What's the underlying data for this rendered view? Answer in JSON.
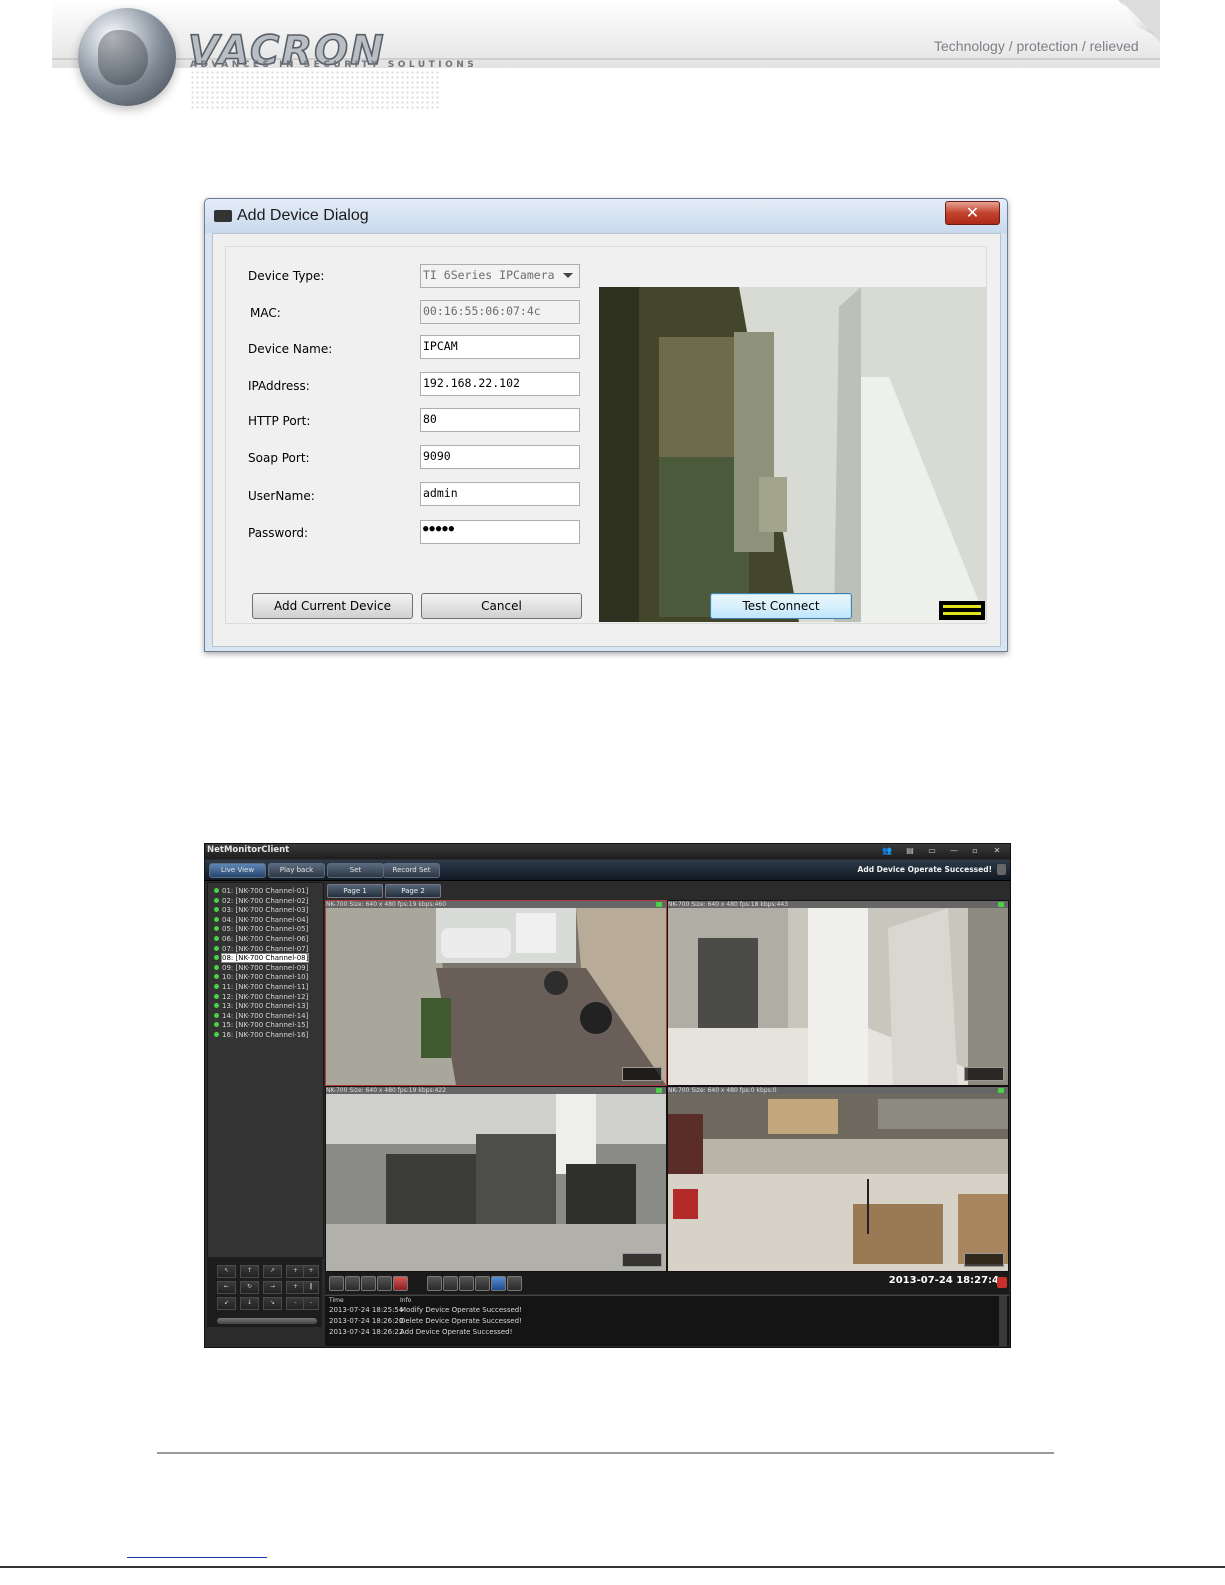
{
  "header": {
    "brand": "VACRON",
    "brand_sub": "ADVANCES IN SECURITY SOLUTIONS",
    "tagline": "Technology / protection / relieved"
  },
  "dialog": {
    "title": "Add Device Dialog",
    "close_glyph": "✕",
    "fields": [
      {
        "label": "Device Type:",
        "value": "TI 6Series IPCamera"
      },
      {
        "label": "MAC:",
        "value": "00:16:55:06:07:4c"
      },
      {
        "label": "Device Name:",
        "value": "IPCAM"
      },
      {
        "label": "IPAddress:",
        "value": "192.168.22.102"
      },
      {
        "label": "HTTP Port:",
        "value": "80"
      },
      {
        "label": "Soap Port:",
        "value": "9090"
      },
      {
        "label": "UserName:",
        "value": "admin"
      },
      {
        "label": "Password:",
        "value": "●●●●●"
      }
    ],
    "buttons": {
      "add": "Add Current Device",
      "cancel": "Cancel",
      "test": "Test Connect"
    }
  },
  "client": {
    "title": "NetMonitorClient",
    "window_buttons": [
      "👥",
      "▤",
      "▭",
      "—",
      "▫",
      "✕"
    ],
    "tabs": [
      "Live View",
      "Play back",
      "Set",
      "Record Set"
    ],
    "status": "Add Device Operate Successed!",
    "channels": [
      "01: [NK-700 Channel-01]",
      "02: [NK-700 Channel-02]",
      "03: [NK-700 Channel-03]",
      "04: [NK-700 Channel-04]",
      "05: [NK-700 Channel-05]",
      "06: [NK-700 Channel-06]",
      "07: [NK-700 Channel-07]",
      "08: [NK-700 Channel-08]",
      "09: [NK-700 Channel-09]",
      "10: [NK-700 Channel-10]",
      "11: [NK-700 Channel-11]",
      "12: [NK-700 Channel-12]",
      "13: [NK-700 Channel-13]",
      "14: [NK-700 Channel-14]",
      "15: [NK-700 Channel-15]",
      "16: [NK-700 Channel-16]"
    ],
    "selected_channel": 7,
    "pages": [
      "Page 1",
      "Page 2"
    ],
    "cameras": [
      {
        "caption": "NK-700 Size: 640 x 480 fps:19 kbps:460"
      },
      {
        "caption": "NK-700 Size: 640 x 480 fps:18 kbps:443"
      },
      {
        "caption": "NK-700 Size: 640 x 480 fps:19 kbps:422"
      },
      {
        "caption": "NK-700 Size: 640 x 480 fps:0 kbps:0"
      }
    ],
    "clock": "2013-07-24 18:27:4",
    "log": {
      "headers": [
        "Time",
        "Info"
      ],
      "rows": [
        {
          "time": "2013-07-24 18:25:54",
          "info": "Modify Device Operate Successed!"
        },
        {
          "time": "2013-07-24 18:26:20",
          "info": "Delete Device Operate Successed!"
        },
        {
          "time": "2013-07-24 18:26:22",
          "info": "Add Device Operate Successed!"
        }
      ]
    },
    "ptz_buttons": [
      "↖",
      "↑",
      "↗",
      "+",
      "+",
      "←",
      "↻",
      "→",
      "+",
      "‖",
      "↙",
      "↓",
      "↘",
      "-",
      "-"
    ]
  }
}
